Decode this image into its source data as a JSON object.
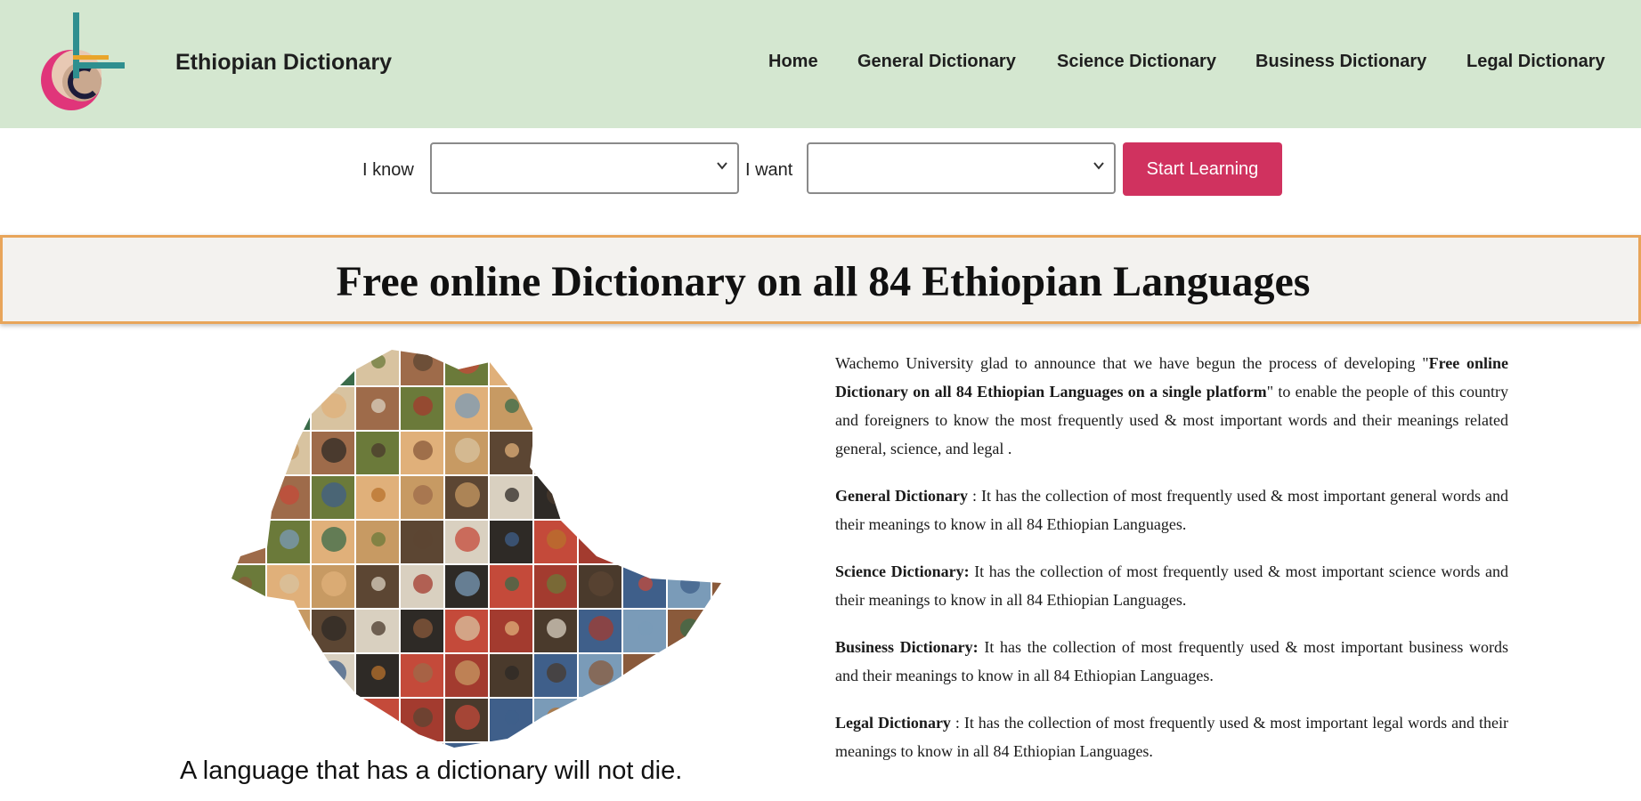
{
  "header": {
    "site_title": "Ethiopian Dictionary",
    "nav": [
      {
        "id": "home",
        "label": "Home"
      },
      {
        "id": "general",
        "label": "General Dictionary"
      },
      {
        "id": "science",
        "label": "Science Dictionary"
      },
      {
        "id": "business",
        "label": "Business Dictionary"
      },
      {
        "id": "legal",
        "label": "Legal Dictionary"
      }
    ],
    "colors": {
      "background": "#d4e7d0"
    }
  },
  "search": {
    "know_label": "I know",
    "know_value": "",
    "want_label": "I want",
    "want_value": "",
    "button_label": "Start Learning",
    "button_color": "#d0325f"
  },
  "banner": {
    "title": "Free online Dictionary on all 84 Ethiopian Languages",
    "border_color": "#e8a55a"
  },
  "tagline": "A language that has a dictionary will not die.",
  "description": {
    "intro_pre": "Wachemo University glad to announce that  we have begun the process of developing  \"",
    "intro_bold": "Free online  Dictionary on all 84 Ethiopian Languages on a single platform",
    "intro_post": "\" to enable the people of this country and foreigners to know the most frequently used & most important words and their meanings related general, science, and legal .",
    "general_term": "General  Dictionary",
    "general_text": " : It has the collection of most frequently used & most important general words and their meanings to know in all 84 Ethiopian Languages.",
    "science_term": "Science Dictionary:",
    "science_text": " It has the collection of most frequently used & most important science words and their meanings to know in all 84 Ethiopian Languages.",
    "business_term": "Business Dictionary:",
    "business_text": " It has the collection of most frequently used & most important business words and their meanings to know in all 84 Ethiopian Languages.",
    "legal_term": "Legal Dictionary",
    "legal_text": " : It has the collection of most frequently used & most important legal words and their meanings to know in all 84 Ethiopian Languages."
  },
  "icons": {
    "logo": "dictionary-logo-icon",
    "select_chevron": "chevron-down-icon",
    "map": "ethiopia-photo-mosaic-map"
  }
}
